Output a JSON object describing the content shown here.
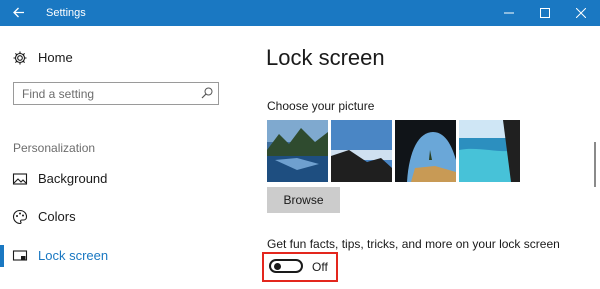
{
  "window": {
    "title": "Settings",
    "accent": "#1a78c2",
    "controls": [
      "minimize-icon",
      "maximize-icon",
      "close-icon"
    ]
  },
  "sidebar": {
    "home_label": "Home",
    "search_placeholder": "Find a setting",
    "section_label": "Personalization",
    "items": [
      {
        "label": "Background",
        "icon": "picture-icon"
      },
      {
        "label": "Colors",
        "icon": "palette-icon"
      },
      {
        "label": "Lock screen",
        "icon": "lock-screen-icon",
        "active": true
      }
    ]
  },
  "main": {
    "title": "Lock screen",
    "choose_label": "Choose your picture",
    "browse_label": "Browse",
    "facts_label": "Get fun facts, tips, tricks, and more on your lock screen",
    "toggle": {
      "state": "Off",
      "value": false,
      "highlight_color": "#e3261d"
    }
  }
}
